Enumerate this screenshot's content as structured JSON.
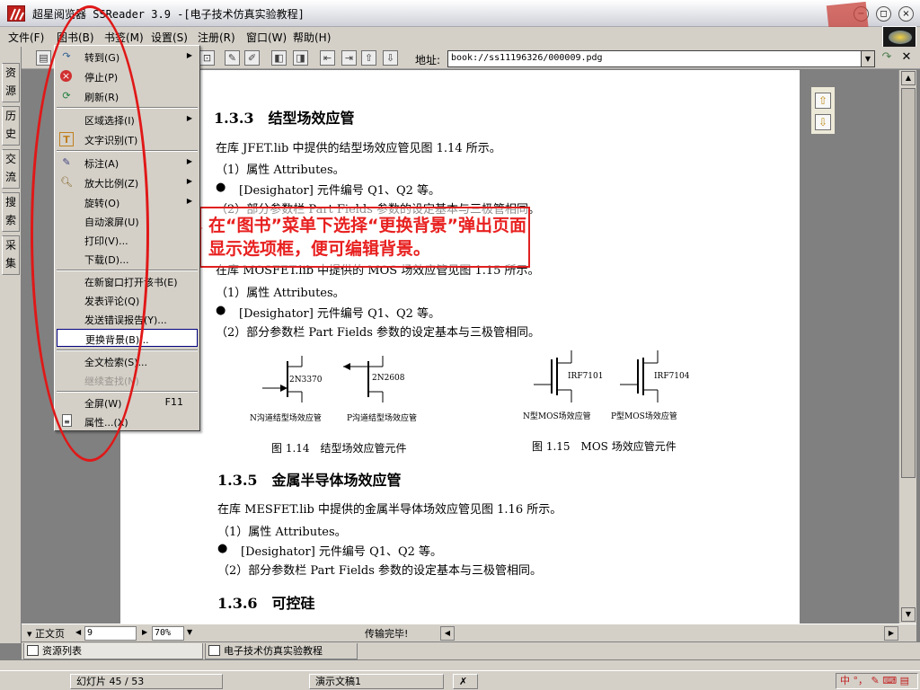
{
  "window": {
    "title": "超星阅览器 SSReader 3.9 -[电子技术仿真实验教程]",
    "minimize_label": "−",
    "restore_label": "◻",
    "close_label": "×"
  },
  "menubar": {
    "items": [
      "文件(F)",
      "图书(B)",
      "书签(M)",
      "设置(S)",
      "注册(R)",
      "窗口(W)",
      "帮助(H)"
    ]
  },
  "toolbar": {
    "address_label": "地址:",
    "address_value": "book://ss11196326/000009.pdg"
  },
  "sidetabs": [
    {
      "label": "资源"
    },
    {
      "label": "历史"
    },
    {
      "label": "交流"
    },
    {
      "label": "搜索"
    },
    {
      "label": "采集"
    }
  ],
  "book_menu": {
    "items": [
      {
        "label": "转到(G)",
        "icon": "turn-icon",
        "submenu": true
      },
      {
        "label": "停止(P)",
        "icon": "stop-icon"
      },
      {
        "label": "刷新(R)",
        "icon": "refresh-icon"
      },
      {
        "label": "区域选择(I)",
        "submenu": true
      },
      {
        "label": "文字识别(T)",
        "icon": "ocr-icon"
      },
      {
        "label": "标注(A)",
        "icon": "annotate-icon",
        "submenu": true
      },
      {
        "label": "放大比例(Z)",
        "icon": "zoom-icon",
        "submenu": true
      },
      {
        "label": "旋转(O)",
        "submenu": true
      },
      {
        "label": "自动滚屏(U)"
      },
      {
        "label": "打印(V)..."
      },
      {
        "label": "下载(D)..."
      },
      {
        "label": "在新窗口打开该书(E)"
      },
      {
        "label": "发表评论(Q)"
      },
      {
        "label": "发送错误报告(Y)..."
      },
      {
        "label": "更换背景(B)..."
      },
      {
        "label": "全文检索(S)..."
      },
      {
        "label": "继续查找(N)"
      },
      {
        "label": "全屏(W)",
        "shortcut": "F11"
      },
      {
        "label": "属性...(X)",
        "icon": "properties-icon"
      }
    ]
  },
  "callout": {
    "text": "在“图书”菜单下选择“更换背景”弹出页面显示选项框，便可编辑背景。",
    "color": "#e82020"
  },
  "document": {
    "s133_heading": "1.3.3　结型场效应管",
    "s133_p1": "在库 JFET.lib 中提供的结型场效应管见图 1.14 所示。",
    "s133_p2": "（1）属性 Attributes。",
    "s133_p3": "[Desighator]  元件编号 Q1、Q2 等。",
    "s133_p4": "（2）部分参数栏 Part Fields 参数的设定基本与三极管相同。",
    "s134_p1": "在库 MOSFET.lib 中提供的 MOS 场效应管见图 1.15 所示。",
    "s134_p2": "（1）属性 Attributes。",
    "s134_p3": "[Desighator]  元件编号 Q1、Q2 等。",
    "s134_p4": "（2）部分参数栏 Part Fields 参数的设定基本与三极管相同。",
    "fig_labels": [
      "2N3370",
      "2N2608",
      "IRF7101",
      "IRF7104"
    ],
    "fig_sublabels": [
      "N沟道结型场效应管",
      "P沟道结型场效应管",
      "N型MOS场效应管",
      "P型MOS场效应管"
    ],
    "fig_caption_114": "图 1.14　结型场效应管元件",
    "fig_caption_115": "图 1.15　MOS 场效应管元件",
    "s135_heading": "1.3.5　金属半导体场效应管",
    "s135_p1": "在库 MESFET.lib 中提供的金属半导体场效应管见图 1.16 所示。",
    "s135_p2": "（1）属性 Attributes。",
    "s135_p3": "[Desighator]  元件编号 Q1、Q2 等。",
    "s135_p4": "（2）部分参数栏 Part Fields 参数的设定基本与三极管相同。",
    "s136_heading": "1.3.6　可控硅",
    "bullet": "●"
  },
  "statusbar": {
    "view_mode": "正文页",
    "page_value": "9",
    "zoom_value": "70%",
    "status_text": "传输完毕!"
  },
  "tabs": {
    "resource_list": "资源列表",
    "open_book": "电子技术仿真实验教程"
  },
  "taskbar": {
    "slide_counter": "幻灯片 45 / 53",
    "doc_name": "演示文稿1",
    "tray_text": "中 °， ✎ ⌨ ▤"
  }
}
